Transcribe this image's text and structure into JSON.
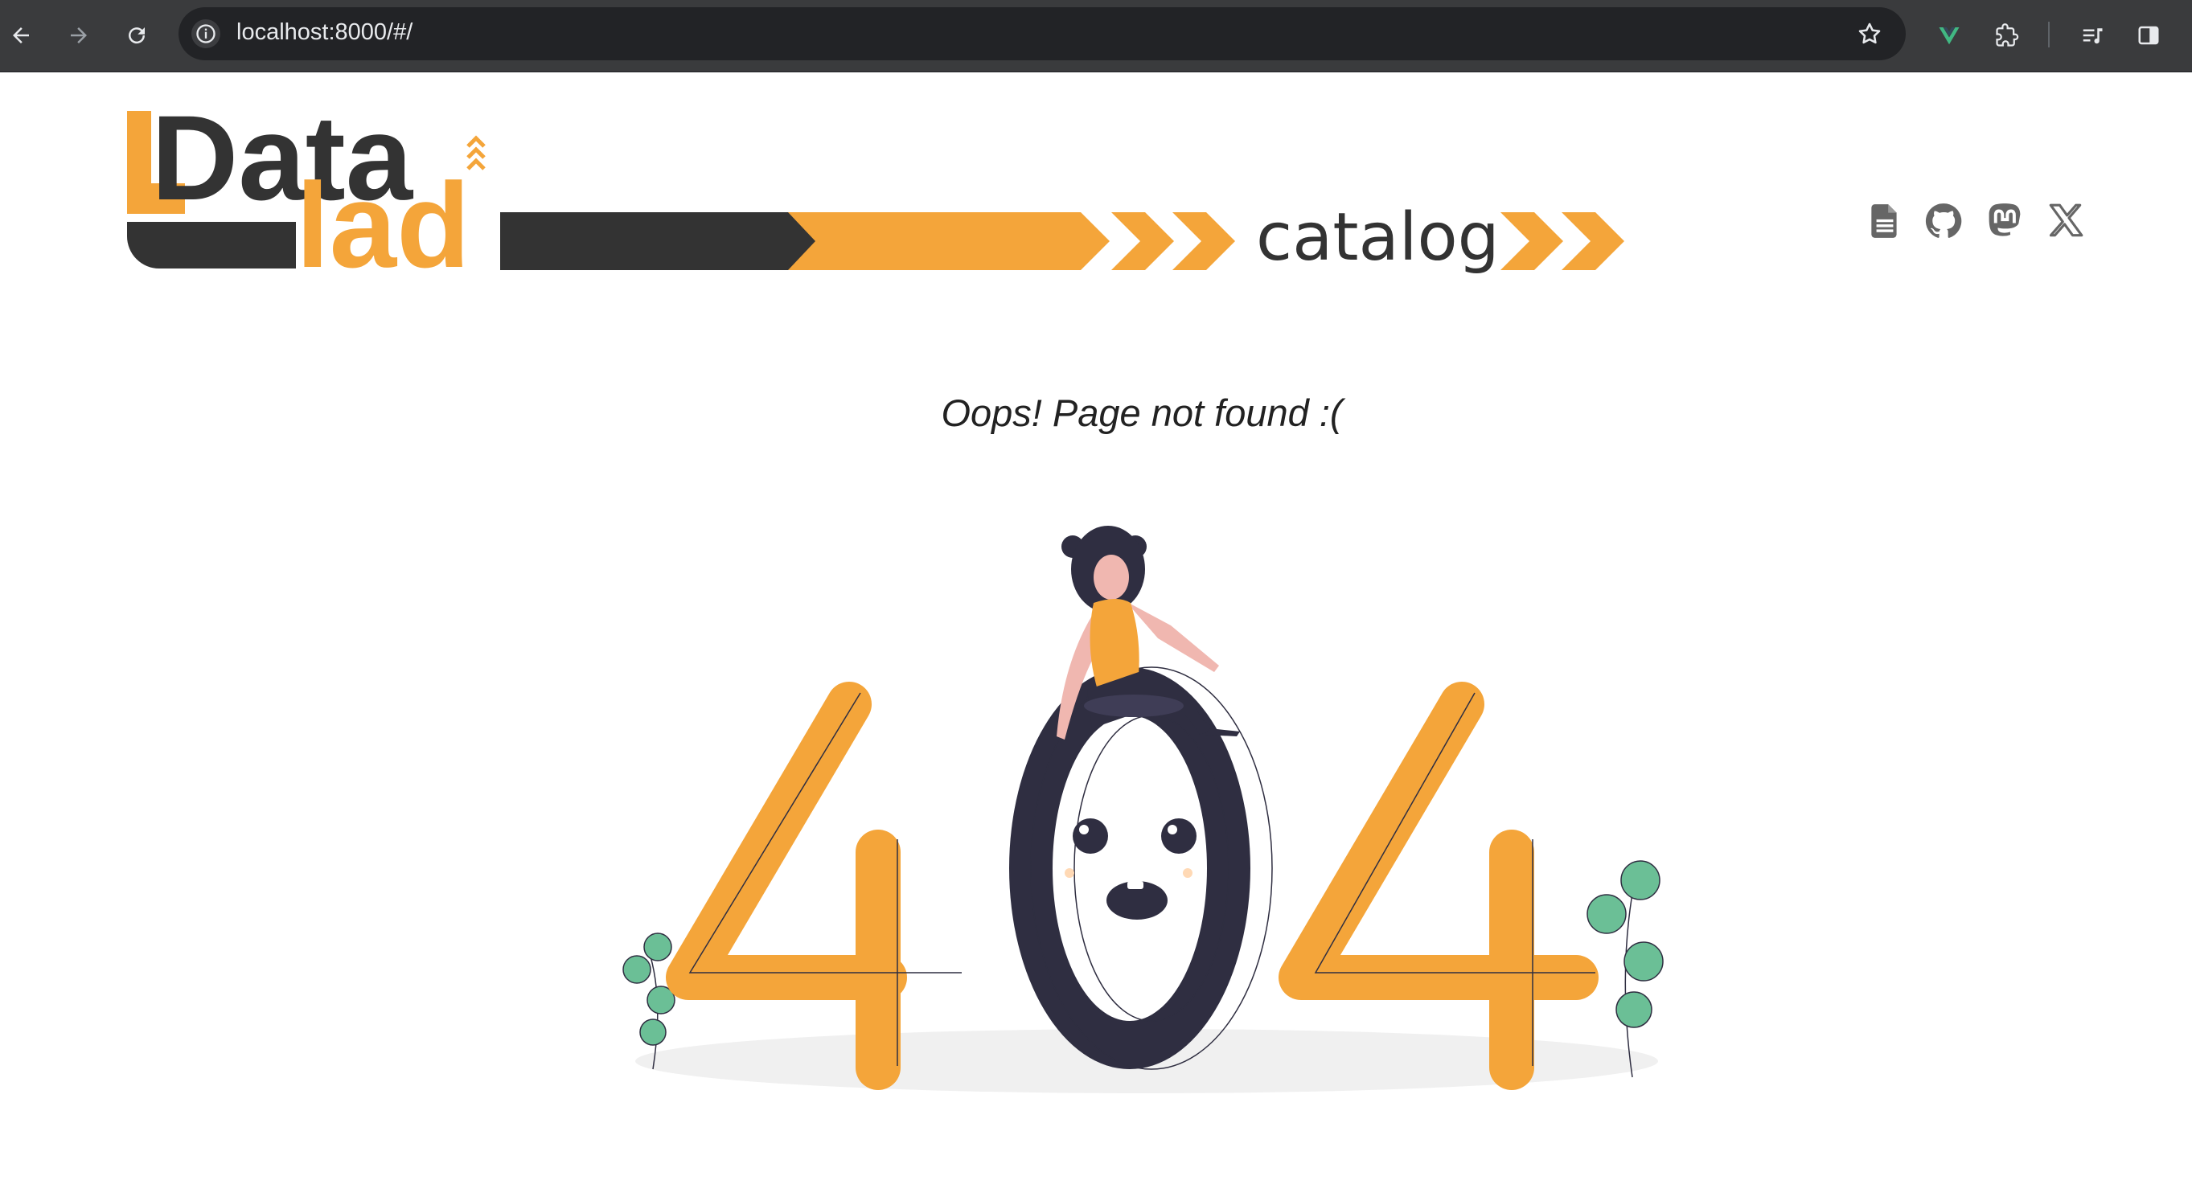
{
  "browser": {
    "url": "localhost:8000/#/",
    "icons": [
      "back-arrow-icon",
      "forward-arrow-icon",
      "reload-icon",
      "site-info-icon",
      "bookmark-star-icon",
      "vue-devtools-icon",
      "extensions-icon",
      "reading-list-icon",
      "side-panel-icon"
    ]
  },
  "header": {
    "logo_word1": "Data",
    "logo_word2": "lad",
    "logo_suffix": "catalog",
    "social_links": [
      {
        "name": "documentation",
        "icon": "document-icon"
      },
      {
        "name": "github",
        "icon": "github-icon"
      },
      {
        "name": "mastodon",
        "icon": "mastodon-icon"
      },
      {
        "name": "x",
        "icon": "x-icon"
      }
    ]
  },
  "main": {
    "message": "Oops! Page not found :(",
    "illustration_text": "404"
  },
  "colors": {
    "accent": "#F4A53A",
    "dark": "#333333",
    "figure_dark": "#2F2E41",
    "plant": "#6BBF96"
  }
}
